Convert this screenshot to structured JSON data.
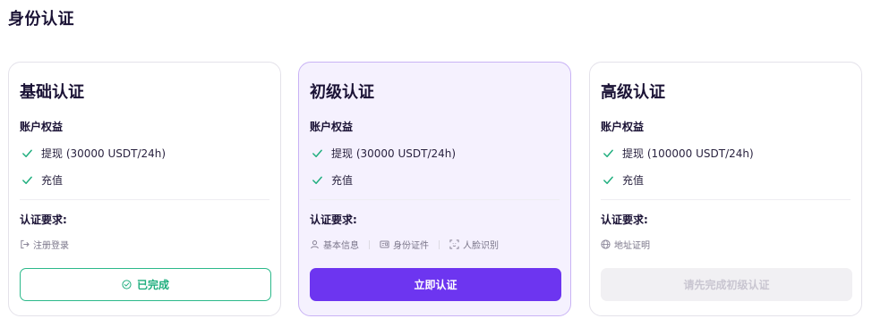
{
  "page": {
    "title": "身份认证"
  },
  "cards": [
    {
      "title": "基础认证",
      "benefits_label": "账户权益",
      "benefits": [
        "提现 (30000 USDT/24h)",
        "充值"
      ],
      "requirements_label": "认证要求:",
      "requirements": [
        {
          "icon": "login-icon",
          "label": "注册登录"
        }
      ],
      "button": {
        "label": "已完成",
        "state": "completed"
      }
    },
    {
      "title": "初级认证",
      "benefits_label": "账户权益",
      "benefits": [
        "提现 (30000 USDT/24h)",
        "充值"
      ],
      "requirements_label": "认证要求:",
      "requirements": [
        {
          "icon": "user-icon",
          "label": "基本信息"
        },
        {
          "icon": "id-card-icon",
          "label": "身份证件"
        },
        {
          "icon": "face-scan-icon",
          "label": "人脸识别"
        }
      ],
      "button": {
        "label": "立即认证",
        "state": "active"
      }
    },
    {
      "title": "高级认证",
      "benefits_label": "账户权益",
      "benefits": [
        "提现 (100000 USDT/24h)",
        "充值"
      ],
      "requirements_label": "认证要求:",
      "requirements": [
        {
          "icon": "globe-icon",
          "label": "地址证明"
        }
      ],
      "button": {
        "label": "请先完成初级认证",
        "state": "disabled"
      }
    }
  ],
  "colors": {
    "primary": "#6d35f0",
    "success": "#1fae7e",
    "highlight_bg": "#f5f1fe",
    "highlight_border": "#c9b3f5",
    "disabled_bg": "#f1f0f3",
    "disabled_text": "#c9c6d1"
  }
}
